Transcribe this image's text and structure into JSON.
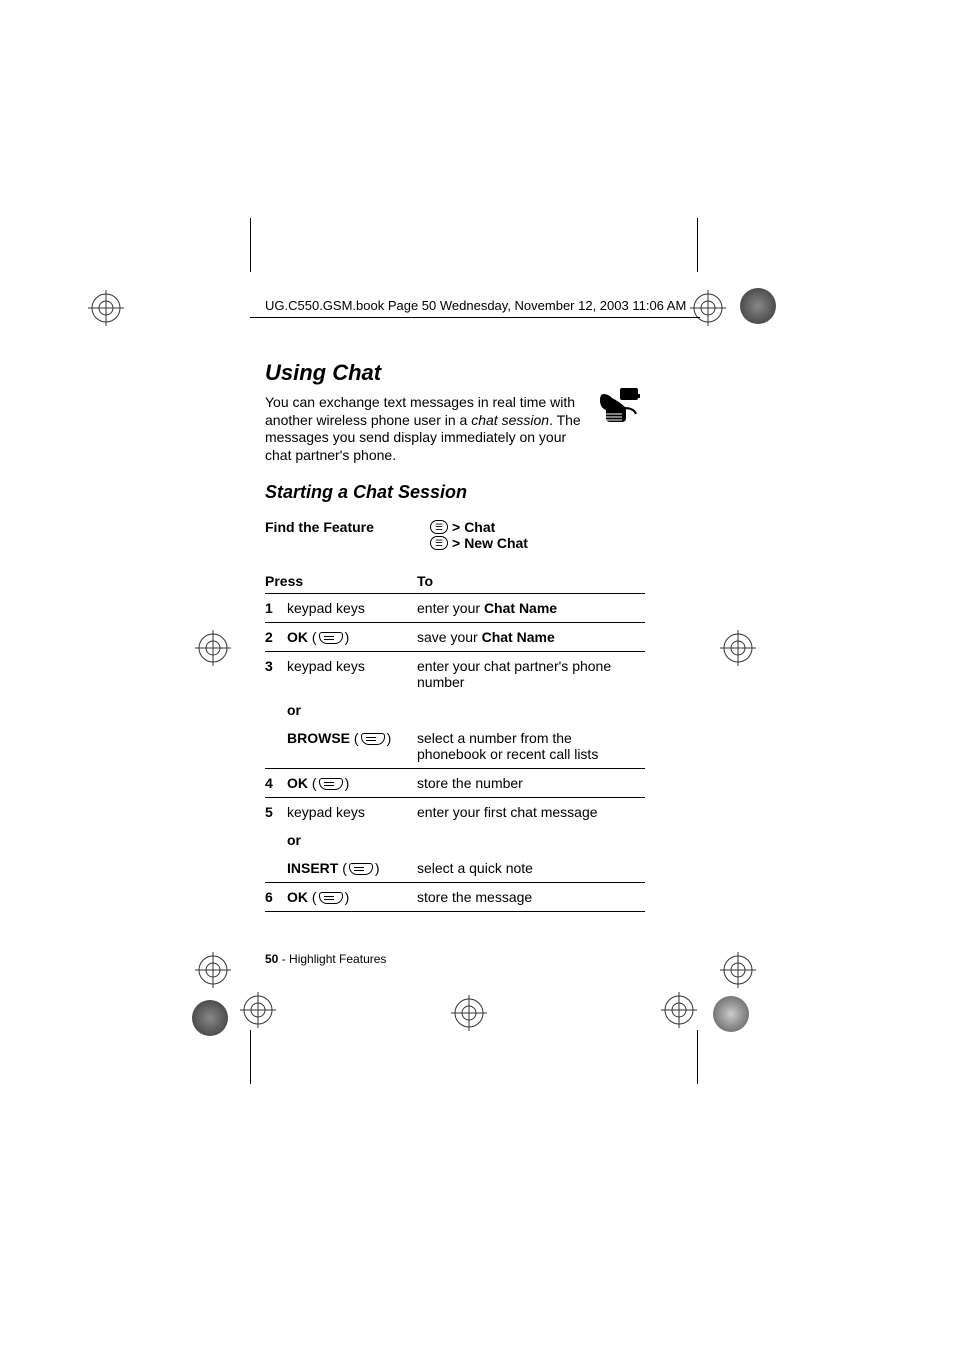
{
  "running_head": "UG.C550.GSM.book  Page 50  Wednesday, November 12, 2003  11:06 AM",
  "section_title": "Using Chat",
  "intro_pre": "You can exchange text messages in real time with another wireless phone user in a ",
  "intro_italic": "chat session",
  "intro_post": ". The messages you send display immediately on your chat partner's phone.",
  "sub_title": "Starting a Chat Session",
  "feature_label": "Find the Feature",
  "path_line1_menu": "Chat",
  "path_line2_menu": "New Chat",
  "gt": ">",
  "table": {
    "head_press": "Press",
    "head_to": "To",
    "rows": [
      {
        "n": "1",
        "press": "keypad keys",
        "to_pre": "enter your ",
        "to_bold": "Chat Name"
      },
      {
        "n": "2",
        "press_bold": "OK",
        "softkey": true,
        "to_pre": "save your ",
        "to_bold": "Chat Name"
      },
      {
        "n": "3",
        "press": "keypad keys",
        "to": "enter your chat partner's phone number"
      },
      {
        "or": "or"
      },
      {
        "press_bold": "BROWSE",
        "softkey": true,
        "to": "select a number from the phonebook or recent call lists"
      },
      {
        "n": "4",
        "press_bold": "OK",
        "softkey": true,
        "to": "store the number"
      },
      {
        "n": "5",
        "press": "keypad keys",
        "to": "enter your first chat message"
      },
      {
        "or": "or"
      },
      {
        "press_bold": "INSERT",
        "softkey": true,
        "to": "select a quick note"
      },
      {
        "n": "6",
        "press_bold": "OK",
        "softkey": true,
        "to": "store the message"
      }
    ]
  },
  "footer_page": "50",
  "footer_text": " - Highlight Features"
}
